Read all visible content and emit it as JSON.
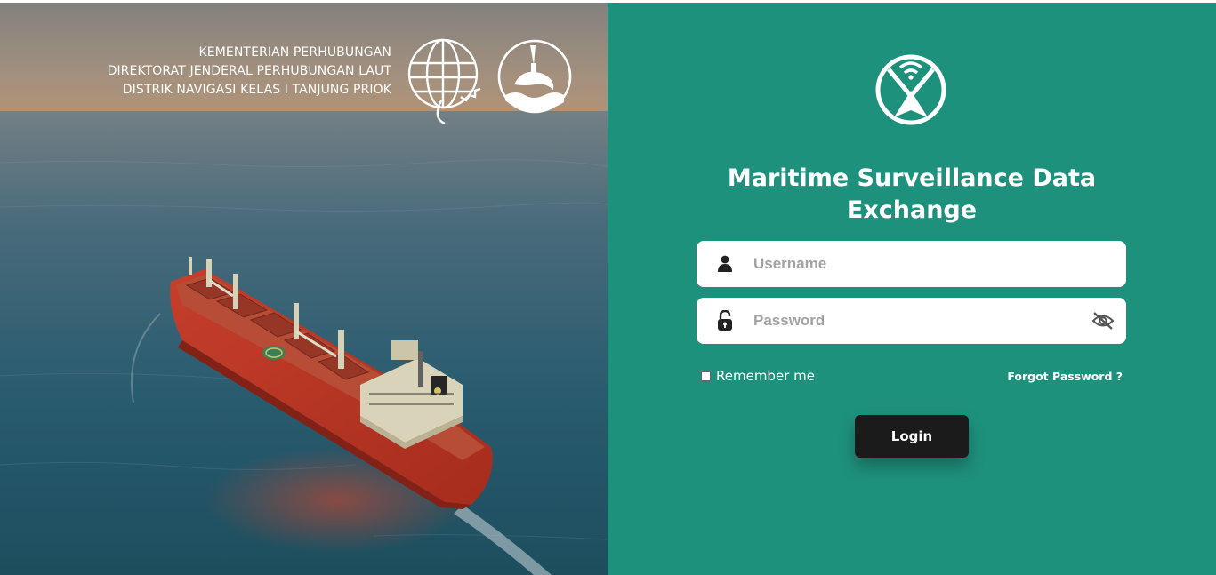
{
  "hero": {
    "header_lines": [
      "KEMENTERIAN PERHUBUNGAN",
      "DIREKTORAT JENDERAL PERHUBUNGAN LAUT",
      "DISTRIK NAVIGASI KELAS I TANJUNG PRIOK"
    ],
    "emblems": [
      "globe-emblem",
      "dolphin-torch-emblem"
    ],
    "image": "cargo-ship-at-sea"
  },
  "login": {
    "logo_icon": "wifi-compass-logo",
    "title": "Maritime Surveillance Data Exchange",
    "username": {
      "placeholder": "Username",
      "value": "",
      "icon": "user-icon"
    },
    "password": {
      "placeholder": "Password",
      "value": "",
      "icon": "lock-icon",
      "toggle_icon": "eye-slash-icon"
    },
    "remember_label": "Remember me",
    "remember_checked": false,
    "forgot_label": "Forgot Password ?",
    "login_label": "Login"
  },
  "colors": {
    "panel_bg": "#1e917c",
    "button_bg": "#1b1b1b",
    "field_bg": "#ffffff",
    "placeholder": "#a3a3a3",
    "ship_hull": "#d8412e"
  }
}
